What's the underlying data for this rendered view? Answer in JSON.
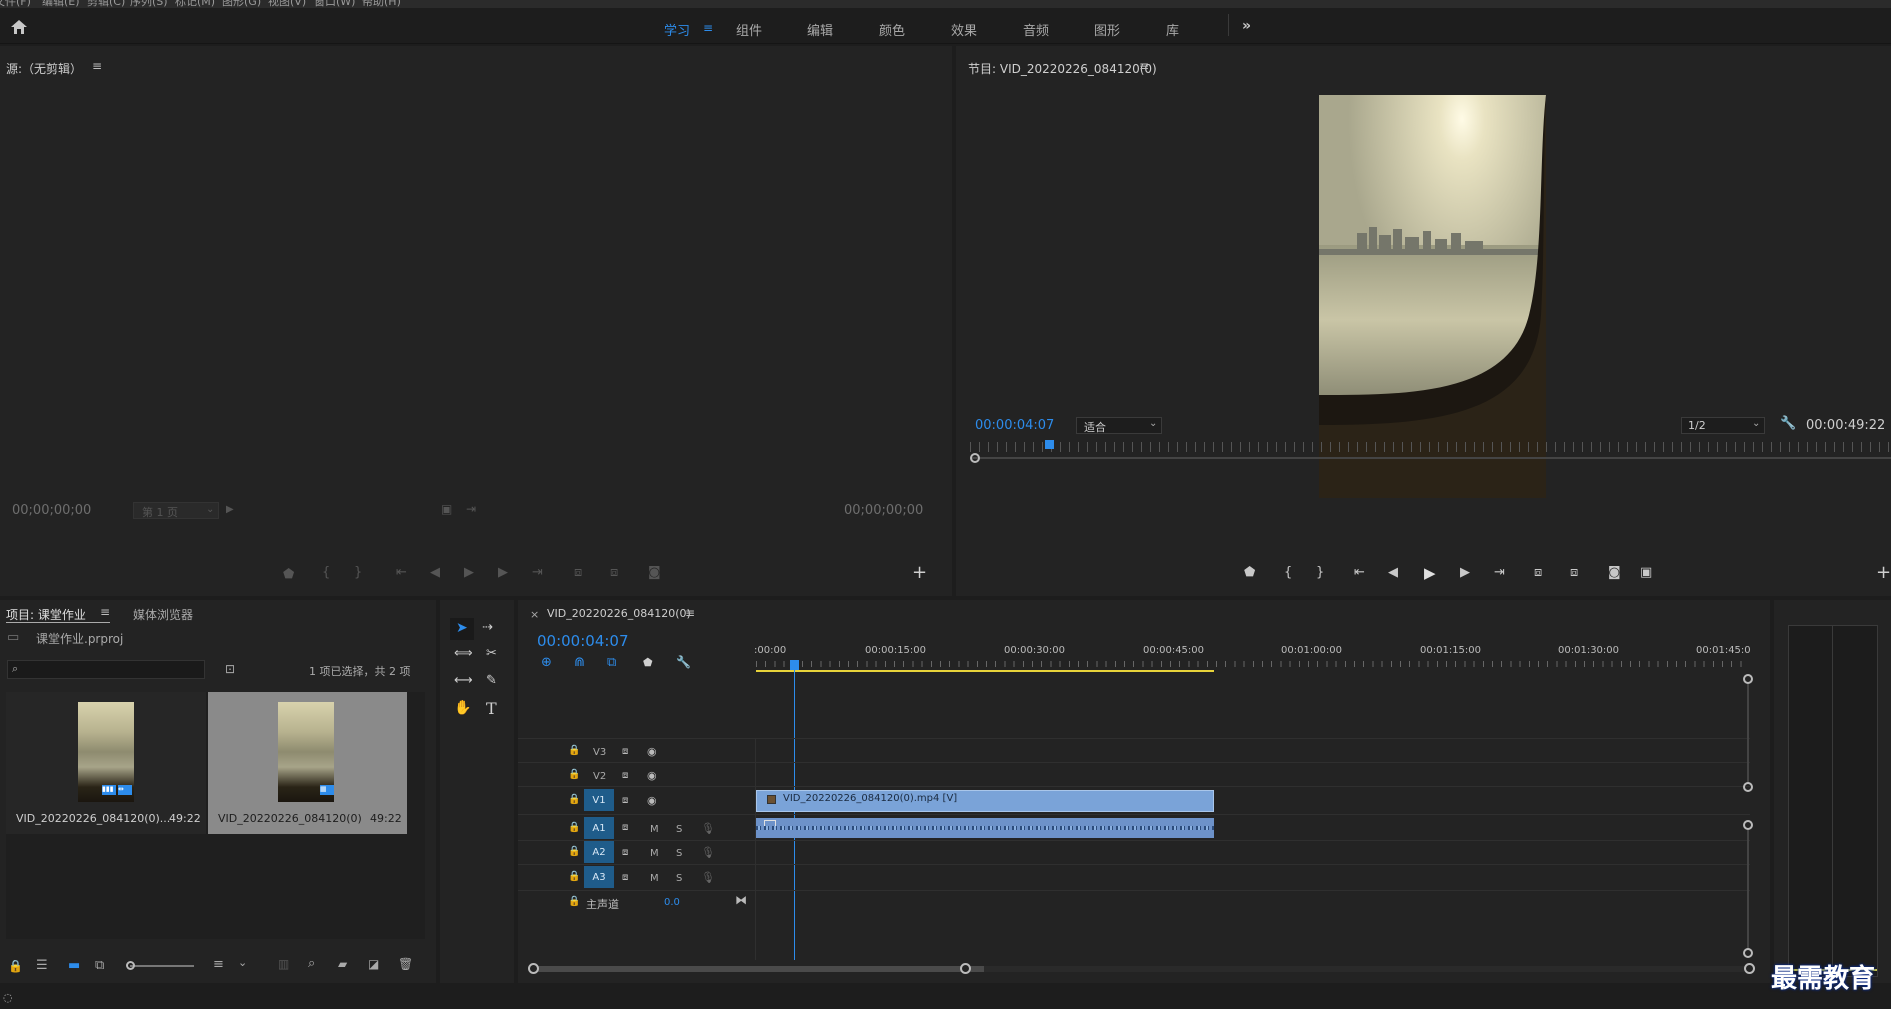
{
  "menu": [
    "文件(F)",
    "编辑(E)",
    "剪辑(C)",
    "序列(S)",
    "标记(M)",
    "图形(G)",
    "视图(V)",
    "窗口(W)",
    "帮助(H)"
  ],
  "workspaces": [
    {
      "label": "学习",
      "active": true
    },
    {
      "label": "组件"
    },
    {
      "label": "编辑"
    },
    {
      "label": "颜色"
    },
    {
      "label": "效果"
    },
    {
      "label": "音频"
    },
    {
      "label": "图形"
    },
    {
      "label": "库"
    }
  ],
  "source": {
    "title": "源:（无剪辑）",
    "tc_left": "00;00;00;00",
    "page_label": "第 1 页",
    "tc_right": "00;00;00;00"
  },
  "program": {
    "title": "节目: VID_20220226_084120(0)",
    "timecode": "00:00:04:07",
    "fit": "适合",
    "quality": "1/2",
    "duration": "00:00:49:22"
  },
  "project": {
    "tab_project": "项目: 课堂作业",
    "tab_media": "媒体浏览器",
    "file": "课堂作业.prproj",
    "selection": "1 项已选择，共 2 项",
    "items": [
      {
        "name": "VID_20220226_084120(0)...",
        "duration": "49:22"
      },
      {
        "name": "VID_20220226_084120(0)",
        "duration": "49:22"
      }
    ]
  },
  "timeline": {
    "seq_name": "VID_20220226_084120(0)",
    "timecode": "00:00:04:07",
    "ruler": [
      ":00:00",
      "00:00:15:00",
      "00:00:30:00",
      "00:00:45:00",
      "00:01:00:00",
      "00:01:15:00",
      "00:01:30:00",
      "00:01:45:0"
    ],
    "video_tracks": [
      "V3",
      "V2",
      "V1"
    ],
    "audio_tracks": [
      "A1",
      "A2",
      "A3"
    ],
    "master_label": "主声道",
    "master_value": "0.0",
    "clip_label": "VID_20220226_084120(0).mp4 [V]",
    "m": "M",
    "s": "S"
  },
  "watermark": "最需教育"
}
